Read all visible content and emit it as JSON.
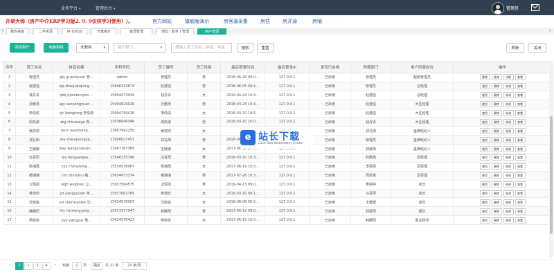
{
  "topbar": {
    "menus": [
      {
        "label": "业务平台"
      },
      {
        "label": "管理后台"
      }
    ],
    "user": "管理员"
  },
  "banner": {
    "promo": "开单大师（房产中介ERP学习版2. 9. 9仅供学习使用！）。",
    "links": [
      "官方网站",
      "旗舰版演示",
      "房客源采集",
      "房估",
      "房开源",
      "房哨"
    ]
  },
  "tabs": [
    "我的桌面",
    "二手房源",
    "M-10018",
    "开盘房价",
    "客源管理",
    "岗位 | 职务 | 管理",
    "用户管理",
    "»"
  ],
  "toolbar": {
    "add_user": "添加用户",
    "batch": "电脑审核",
    "status_select": "未删除",
    "dept_select": "用户部门",
    "search_placeholder": "请输入员工姓名、拼音、电话",
    "search_btn": "搜索",
    "reset_btn": "重置",
    "refresh_btn": "刷新",
    "close_btn": "关闭"
  },
  "table": {
    "headers": [
      "序号",
      "员工姓名",
      "拼音检索",
      "手机号码",
      "员工编号",
      "员工性别",
      "最后登录时间",
      "最后登录IP",
      "是否已启用",
      "所属部门",
      "用户所属岗位",
      "操作"
    ],
    "ops": [
      "使用",
      "删除",
      "修改",
      "查看"
    ],
    "first_ops": [
      "删除",
      "修改",
      "详情",
      "查看"
    ],
    "rows": [
      [
        "1",
        "管理员",
        "gly guanliyuan 管...",
        "admin",
        "管理员",
        "男",
        "2018-06-26 09:0...",
        "127.0.0.1",
        "已启用",
        "管理员",
        "超级管理员"
      ],
      [
        "2",
        "赵建强",
        "zjq zhaojianqiang ...",
        "15606323674",
        "赵建强",
        "男",
        "2018-06-05 09:4...",
        "127.0.0.1",
        "已启用",
        "管理员",
        "总经理"
      ],
      [
        "3",
        "钱丹青",
        "qdq qiandanqian ...",
        "15804473034",
        "钱丹青",
        "女",
        "2019-04-24 14:3...",
        "127.0.0.1",
        "已启用",
        "赵建强",
        "总经理"
      ],
      [
        "4",
        "孙鹏扬",
        "spy sunpengyuan ...",
        "15904629026",
        "孙鹏扬",
        "男",
        "2018-03-23 10:4...",
        "127.0.0.1",
        "已启用",
        "赵建强",
        "大区经理"
      ],
      [
        "5",
        "李倩倩",
        "lyt liqingtong 李倩倩",
        "15904759426",
        "李倩倩",
        "女",
        "2018-03-20 19:5...",
        "127.0.0.1",
        "已启用",
        "赵建强",
        "大区经理"
      ],
      [
        "6",
        "周凯歌",
        "zkg zhoukaige 周...",
        "13036646346",
        "周凯歌",
        "男",
        "2018-03-20 10:0...",
        "127.0.0.1",
        "已启用",
        "钱丹青",
        "大区经理"
      ],
      [
        "7",
        "吴婷婷",
        "wzm wuzimang ...",
        "13807992255",
        "吴婷婷",
        "女",
        "",
        "127.0.0.1",
        "已启用",
        "郑孔阳",
        "金牌经纪人"
      ],
      [
        "8",
        "郑孔阳",
        "zky zhengkongya...",
        "13908627457",
        "郑孔阳",
        "男",
        "2018-06-10 10:0...",
        "127.0.0.1",
        "已启用",
        "管理员",
        "金牌经纪人"
      ],
      [
        "9",
        "王媛媛",
        "wxy wangxuanyin...",
        "13947767369",
        "王媛媛",
        "女",
        "2017-06-19 12:0...",
        "127.0.0.1",
        "已启用",
        "郭晨阳",
        "金牌经纪人"
      ],
      [
        "10",
        "冯青阳",
        "fyq fengyangsu...",
        "13946335796",
        "冯青阳",
        "男",
        "2018-03-30 10:3...",
        "127.0.0.1",
        "已启用",
        "孙鹏扬",
        "区经理"
      ],
      [
        "11",
        "陈瑞霞",
        "cyx chenyixing ...",
        "15534576067",
        "陈瑞霞",
        "女",
        "2017-06-19 15:0...",
        "127.0.0.1",
        "已启用",
        "李倩倩",
        "区经理"
      ],
      [
        "12",
        "褚瑞瑞",
        "chr churuirui 褚...",
        "15634673374",
        "褚瑞瑞",
        "男",
        "2017-07-26 10:3...",
        "127.0.0.1",
        "已启用",
        "周凯歌",
        "区经理"
      ],
      [
        "13",
        "卫恒勋",
        "wgh weighan 卫...",
        "15937564575",
        "卫恒勋",
        "男",
        "2019-04-13 09:0...",
        "127.0.0.1",
        "已启用",
        "吴婷婷",
        "店长"
      ],
      [
        "14",
        "蒋佳欣",
        "jyt jiangyouxin 蒋...",
        "15937663765",
        "蒋佳欣",
        "女",
        "2018-03-30 09:1...",
        "127.0.0.1",
        "已启用",
        "冯青阳",
        "店长"
      ],
      [
        "15",
        "沈晓淼",
        "sxl shenxiaolan 沈...",
        "15634576957",
        "沈晓淼",
        "女",
        "2018-06-08 09:5...",
        "127.0.0.1",
        "已启用",
        "王媛媛",
        "店长"
      ],
      [
        "16",
        "韩腾阳",
        "hty hantengyang ...",
        "15973377547",
        "韩腾阳",
        "男",
        "2017-06-19 09:0...",
        "127.0.0.1",
        "已启用",
        "郭晨阳",
        "组长"
      ],
      [
        "17",
        "杨依依",
        "yyy yangyiyi 杨...",
        "15634576427",
        "杨依依",
        "女",
        "2017-06-19 10:0...",
        "127.0.0.1",
        "已启用",
        "韩腾阳",
        "置业顾问"
      ]
    ]
  },
  "watermark": {
    "title": "站长下载",
    "sub": "Each Dao Webmaster Center"
  },
  "pager": {
    "pages": [
      "‹",
      "1",
      "2",
      "3",
      "4",
      "›"
    ],
    "goto_label": "到第",
    "page_value": "1",
    "page_unit": "页",
    "confirm": "确定",
    "total": "共 31 条",
    "per_page": "20 条/页"
  }
}
